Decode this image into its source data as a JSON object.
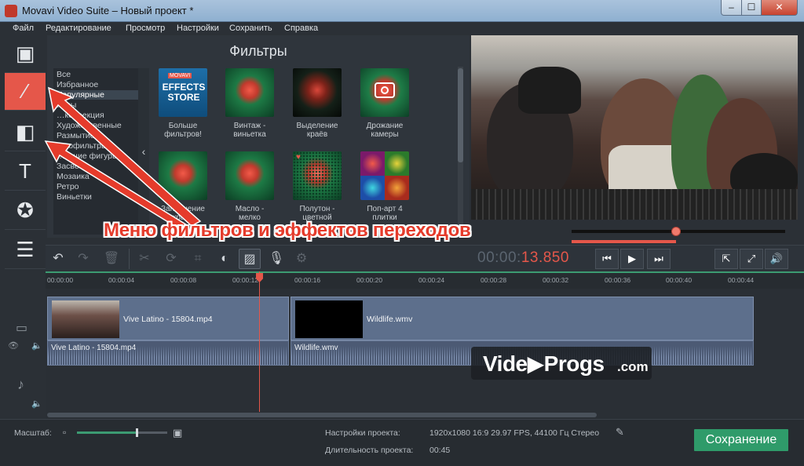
{
  "window": {
    "title": "Movavi Video Suite – Новый проект *",
    "min": "–",
    "max": "☐",
    "close": "✕"
  },
  "menu": [
    "Файл",
    "Редактирование",
    "Просмотр",
    "Настройки",
    "Сохранить",
    "Справка"
  ],
  "panel": {
    "title": "Фильтры",
    "categories": [
      "Все",
      "Избранное",
      "Популярные",
      "…мы",
      "…коррекция",
      "Художественные",
      "Размытие",
      "…тофильтры",
      "…ющие фигуры",
      "Засвет",
      "Мозаика",
      "Ретро",
      "Виньетки"
    ],
    "selected_category": "Популярные",
    "filters": [
      {
        "line1": "Больше",
        "line2": "фильтров!",
        "store_badge": "MOVAVI",
        "store_text": "EFFECTS STORE"
      },
      {
        "line1": "Винтаж -",
        "line2": "виньетка"
      },
      {
        "line1": "Выделение",
        "line2": "краёв"
      },
      {
        "line1": "Дрожание",
        "line2": "камеры"
      },
      {
        "line1": "Заполнение",
        "line2": "краёв"
      },
      {
        "line1": "Масло -",
        "line2": "мелко"
      },
      {
        "line1": "Полутон -",
        "line2": "цветной"
      },
      {
        "line1": "Поп-арт 4",
        "line2": "плитки"
      }
    ]
  },
  "player": {
    "time_dim": "00:00:",
    "time_lit": "13.850",
    "progress_fraction": 0.49
  },
  "ruler": [
    "00:00:00",
    "00:00:04",
    "00:00:08",
    "00:00:12",
    "00:00:16",
    "00:00:20",
    "00:00:24",
    "00:00:28",
    "00:00:32",
    "00:00:36",
    "00:00:40",
    "00:00:44"
  ],
  "timeline": {
    "video_clips": [
      "Vive Latino - 15804.mp4",
      "Wildlife.wmv"
    ],
    "audio_clips": [
      "Vive Latino - 15804.mp4",
      "Wildlife.wmv"
    ]
  },
  "status": {
    "zoom_label": "Масштаб:",
    "zoom_fraction": 0.65,
    "settings_label": "Настройки проекта:",
    "settings_value": "1920x1080 16:9 29.97 FPS, 44100 Гц Стерео",
    "duration_label": "Длительность проекта:",
    "duration_value": "00:45",
    "save_button": "Сохранение"
  },
  "annotation": "Меню фильтров и эффектов переходов",
  "watermark": {
    "main": "Vide▶Progs",
    "suffix": ".com"
  },
  "colors": {
    "accent": "#e5574a",
    "save": "#2f9b6a",
    "ruler_line": "#3c9b72"
  },
  "icons": [
    "video-icon",
    "magic-wand-icon",
    "transition-icon",
    "text-icon",
    "sticker-icon",
    "menu-list-icon",
    "undo-icon",
    "redo-icon",
    "trash-icon",
    "cut-icon",
    "rotate-icon",
    "crop-icon",
    "color-icon",
    "image-icon",
    "mic-icon",
    "gear-icon",
    "prev-icon",
    "play-icon",
    "next-icon",
    "export-icon",
    "fullscreen-icon",
    "volume-icon",
    "eye-icon",
    "music-icon",
    "pencil-icon"
  ]
}
